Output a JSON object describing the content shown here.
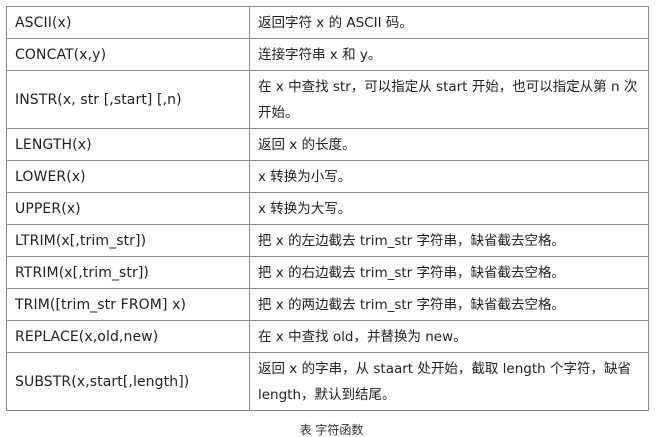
{
  "table": {
    "rows": [
      {
        "function": "ASCII(x)",
        "description": "返回字符 x 的 ASCII 码。"
      },
      {
        "function": "CONCAT(x,y)",
        "description": "连接字符串 x 和 y。"
      },
      {
        "function": "INSTR(x, str [,start] [,n)",
        "description": "在 x 中查找 str，可以指定从 start 开始，也可以指定从第 n 次开始。"
      },
      {
        "function": "LENGTH(x)",
        "description": "返回 x 的长度。"
      },
      {
        "function": "LOWER(x)",
        "description": "x 转换为小写。"
      },
      {
        "function": "UPPER(x)",
        "description": "x 转换为大写。"
      },
      {
        "function": "LTRIM(x[,trim_str])",
        "description": "把 x 的左边截去 trim_str 字符串，缺省截去空格。"
      },
      {
        "function": "RTRIM(x[,trim_str])",
        "description": "把 x 的右边截去 trim_str 字符串，缺省截去空格。"
      },
      {
        "function": "TRIM([trim_str FROM] x)",
        "description": "把 x 的两边截去 trim_str 字符串，缺省截去空格。"
      },
      {
        "function": "REPLACE(x,old,new)",
        "description": "在 x 中查找 old，并替换为 new。"
      },
      {
        "function": "SUBSTR(x,start[,length])",
        "description": "返回 x 的字串，从 staart 处开始，截取 length 个字符，缺省 length，默认到结尾。"
      }
    ]
  },
  "caption": "表 字符函数"
}
